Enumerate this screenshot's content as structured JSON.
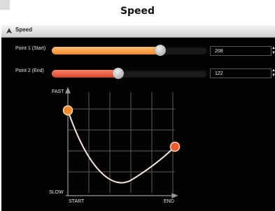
{
  "page": {
    "title": "Speed"
  },
  "window": {
    "title": "Speed",
    "icon": "speed-app-icon"
  },
  "sliders": [
    {
      "label": "Point 1 (Start)",
      "value": "208",
      "level": 0.7,
      "color": "#f08a2a"
    },
    {
      "label": "Point 2 (End)",
      "value": "122",
      "level": 0.43,
      "color": "#d8412a"
    }
  ],
  "graph": {
    "y_top": "FAST",
    "y_bottom": "SLOW",
    "x_left": "START",
    "x_right": "END",
    "curve_color": "#f3e3d8",
    "grid_color": "#5c5c5c",
    "point_colors": [
      "#f0882c",
      "#ee5a30"
    ]
  }
}
